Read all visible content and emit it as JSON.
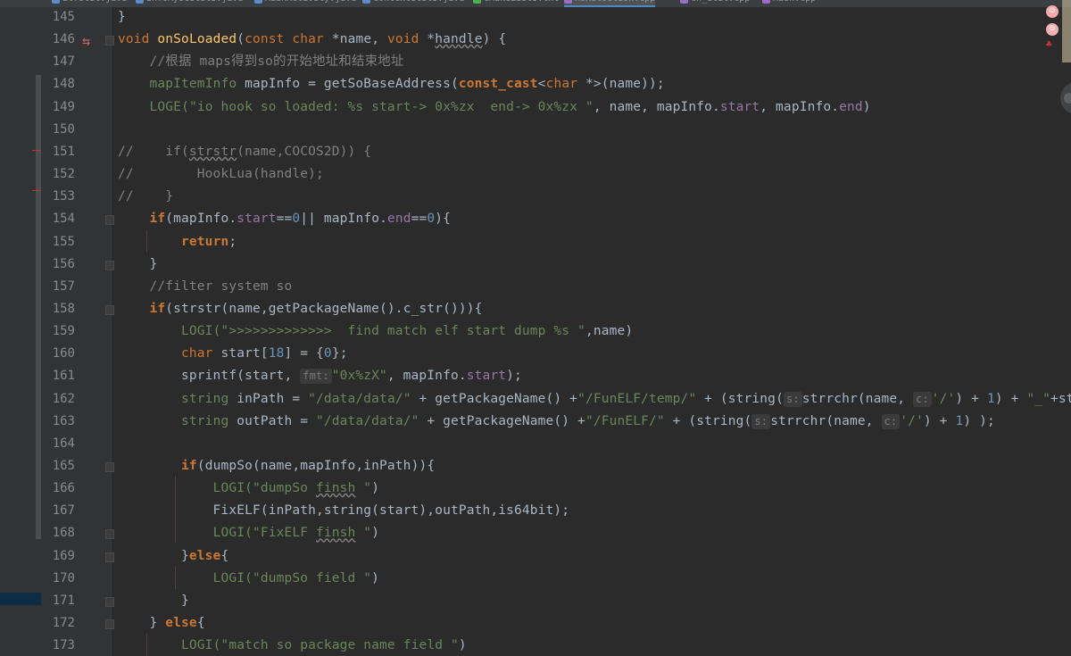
{
  "tabs": [
    {
      "label": "ElfUtil.java",
      "color": "#5e8ac7"
    },
    {
      "label": "InfoMyseUtils.java",
      "color": "#5e8ac7"
    },
    {
      "label": "MainActivity.java",
      "color": "#5e8ac7"
    },
    {
      "label": "ContextUtils.java",
      "color": "#5e8ac7"
    },
    {
      "label": "CMakeLists.txt",
      "color": "#4caf50"
    },
    {
      "label": "RoReloction.cpp",
      "color": "#9c6cc7",
      "active": true
    },
    {
      "label": "cn_util.cpp",
      "color": "#9c6cc7"
    },
    {
      "label": "Main.cpp",
      "color": "#9c6cc7"
    }
  ],
  "overlay": {
    "icon1": "smile-icon",
    "icon2": "smile-icon",
    "icon3": "cat-icon"
  },
  "code": {
    "lines": [
      {
        "num": "145",
        "segs": [
          [
            "p",
            "}"
          ]
        ]
      },
      {
        "num": "146",
        "segs": [
          [
            "t",
            "void"
          ],
          [
            "p",
            " "
          ],
          [
            "fn",
            "onSoLoaded"
          ],
          [
            "p",
            "("
          ],
          [
            "t",
            "const"
          ],
          [
            "p",
            " "
          ],
          [
            "t",
            "char"
          ],
          [
            "p",
            " *name, "
          ],
          [
            "t",
            "void"
          ],
          [
            "p",
            " *"
          ],
          [
            "ul",
            "handle"
          ],
          [
            "p",
            ") {"
          ]
        ]
      },
      {
        "num": "147",
        "segs": [
          [
            "p",
            "    "
          ],
          [
            "c",
            "//根据 maps得到so的开始地址和结束地址"
          ]
        ]
      },
      {
        "num": "148",
        "segs": [
          [
            "p",
            "    "
          ],
          [
            "mac",
            "mapItemInfo"
          ],
          [
            "p",
            " mapInfo = getSoBaseAddress("
          ],
          [
            "k",
            "const_cast"
          ],
          [
            "p",
            "<"
          ],
          [
            "t",
            "char"
          ],
          [
            "p",
            " *>(name));"
          ]
        ]
      },
      {
        "num": "149",
        "segs": [
          [
            "p",
            "    "
          ],
          [
            "mac",
            "LOGE"
          ],
          [
            "s",
            "(\"io hook so loaded: %s start-> 0x%zx  end-> 0x%zx \""
          ],
          [
            "p",
            ", name, mapInfo."
          ],
          [
            "m",
            "start"
          ],
          [
            "p",
            ", mapInfo."
          ],
          [
            "m",
            "end"
          ],
          [
            "p",
            ")"
          ]
        ]
      },
      {
        "num": "150",
        "segs": [
          [
            "p",
            ""
          ]
        ]
      },
      {
        "num": "151",
        "segs": [
          [
            "c",
            "//    if("
          ],
          [
            "cul",
            "strstr"
          ],
          [
            "c",
            "(name,COCOS2D)) {"
          ]
        ]
      },
      {
        "num": "152",
        "segs": [
          [
            "c",
            "//        HookLua(handle);"
          ]
        ]
      },
      {
        "num": "153",
        "segs": [
          [
            "c",
            "//    }"
          ]
        ]
      },
      {
        "num": "154",
        "segs": [
          [
            "p",
            "    "
          ],
          [
            "k",
            "if"
          ],
          [
            "p",
            "(mapInfo."
          ],
          [
            "m",
            "start"
          ],
          [
            "p",
            "=="
          ],
          [
            "n",
            "0"
          ],
          [
            "p",
            "|| mapInfo."
          ],
          [
            "m",
            "end"
          ],
          [
            "p",
            "=="
          ],
          [
            "n",
            "0"
          ],
          [
            "p",
            "){"
          ]
        ]
      },
      {
        "num": "155",
        "segs": [
          [
            "p",
            "        "
          ],
          [
            "k",
            "return"
          ],
          [
            "p",
            ";"
          ]
        ]
      },
      {
        "num": "156",
        "segs": [
          [
            "p",
            "    }"
          ]
        ]
      },
      {
        "num": "157",
        "segs": [
          [
            "p",
            "    "
          ],
          [
            "c",
            "//filter system so"
          ]
        ]
      },
      {
        "num": "158",
        "segs": [
          [
            "p",
            "    "
          ],
          [
            "k",
            "if"
          ],
          [
            "p",
            "(strstr(name,getPackageName().c_str())){"
          ]
        ]
      },
      {
        "num": "159",
        "segs": [
          [
            "p",
            "        "
          ],
          [
            "mac",
            "LOGI"
          ],
          [
            "s",
            "(\">>>>>>>>>>>>>  find match elf start dump %s \""
          ],
          [
            "p",
            ",name)"
          ]
        ]
      },
      {
        "num": "160",
        "segs": [
          [
            "p",
            "        "
          ],
          [
            "t",
            "char"
          ],
          [
            "p",
            " start["
          ],
          [
            "n",
            "18"
          ],
          [
            "p",
            "] = {"
          ],
          [
            "n",
            "0"
          ],
          [
            "p",
            "};"
          ]
        ]
      },
      {
        "num": "161",
        "segs": [
          [
            "p",
            "        sprintf(start, "
          ],
          [
            "hint",
            "fmt:"
          ],
          [
            "s",
            "\"0x%zX\""
          ],
          [
            "p",
            ", mapInfo."
          ],
          [
            "m",
            "start"
          ],
          [
            "p",
            ");"
          ]
        ]
      },
      {
        "num": "162",
        "segs": [
          [
            "p",
            "        "
          ],
          [
            "mac",
            "string"
          ],
          [
            "p",
            " inPath = "
          ],
          [
            "s",
            "\"/data/data/\""
          ],
          [
            "p",
            " + getPackageName() +"
          ],
          [
            "s",
            "\"/FunELF/temp/\""
          ],
          [
            "p",
            " + (string("
          ],
          [
            "hint",
            "s:"
          ],
          [
            "p",
            "strrchr(name, "
          ],
          [
            "hint",
            "c:"
          ],
          [
            "s",
            "'/'"
          ],
          [
            "p",
            ") + "
          ],
          [
            "n",
            "1"
          ],
          [
            "p",
            ") + "
          ],
          [
            "s",
            "\"_\""
          ],
          [
            "p",
            "+start+"
          ],
          [
            "s",
            "\"_"
          ]
        ]
      },
      {
        "num": "163",
        "segs": [
          [
            "p",
            "        "
          ],
          [
            "mac",
            "string"
          ],
          [
            "p",
            " outPath = "
          ],
          [
            "s",
            "\"/data/data/\""
          ],
          [
            "p",
            " + getPackageName() +"
          ],
          [
            "s",
            "\"/FunELF/\""
          ],
          [
            "p",
            " + (string("
          ],
          [
            "hint",
            "s:"
          ],
          [
            "p",
            "strrchr(name, "
          ],
          [
            "hint",
            "c:"
          ],
          [
            "s",
            "'/'"
          ],
          [
            "p",
            ") + "
          ],
          [
            "n",
            "1"
          ],
          [
            "p",
            ") );"
          ]
        ]
      },
      {
        "num": "164",
        "segs": [
          [
            "p",
            ""
          ]
        ]
      },
      {
        "num": "165",
        "segs": [
          [
            "p",
            "        "
          ],
          [
            "k",
            "if"
          ],
          [
            "p",
            "(dumpSo(name,mapInfo,inPath)){"
          ]
        ]
      },
      {
        "num": "166",
        "segs": [
          [
            "p",
            "            "
          ],
          [
            "mac",
            "LOGI"
          ],
          [
            "s",
            "(\"dumpSo "
          ],
          [
            "sul",
            "finsh"
          ],
          [
            "s",
            " \""
          ],
          [
            "p",
            ")"
          ]
        ]
      },
      {
        "num": "167",
        "segs": [
          [
            "p",
            "            FixELF(inPath,string(start),outPath,is64bit);"
          ]
        ]
      },
      {
        "num": "168",
        "segs": [
          [
            "p",
            "            "
          ],
          [
            "mac",
            "LOGI"
          ],
          [
            "s",
            "(\"FixELF "
          ],
          [
            "sul",
            "finsh"
          ],
          [
            "s",
            " \""
          ],
          [
            "p",
            ")"
          ]
        ]
      },
      {
        "num": "169",
        "segs": [
          [
            "p",
            "        }"
          ],
          [
            "k",
            "else"
          ],
          [
            "p",
            "{"
          ]
        ]
      },
      {
        "num": "170",
        "segs": [
          [
            "p",
            "            "
          ],
          [
            "mac",
            "LOGI"
          ],
          [
            "s",
            "(\"dumpSo field \""
          ],
          [
            "p",
            ")"
          ]
        ]
      },
      {
        "num": "171",
        "segs": [
          [
            "p",
            "        }"
          ]
        ]
      },
      {
        "num": "172",
        "segs": [
          [
            "p",
            "    } "
          ],
          [
            "k",
            "else"
          ],
          [
            "p",
            "{"
          ]
        ]
      },
      {
        "num": "173",
        "segs": [
          [
            "p",
            "        "
          ],
          [
            "mac",
            "LOGI"
          ],
          [
            "s",
            "(\"match so package name field \""
          ],
          [
            "p",
            ")"
          ]
        ]
      }
    ]
  }
}
